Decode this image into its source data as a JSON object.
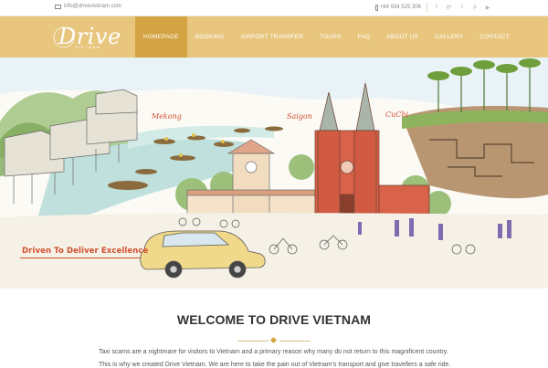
{
  "topbar": {
    "email": "info@drivevietnam.com",
    "phone": "+84 934 525 306",
    "social": [
      {
        "icon": "facebook-icon",
        "glyph": "f"
      },
      {
        "icon": "google-plus-icon",
        "glyph": "g+"
      },
      {
        "icon": "twitter-icon",
        "glyph": "t"
      },
      {
        "icon": "pinterest-icon",
        "glyph": "p"
      },
      {
        "icon": "youtube-icon",
        "glyph": "▶"
      }
    ]
  },
  "logo": {
    "word": "Drive",
    "sub": "VIETNAM"
  },
  "nav": {
    "items": [
      "HOMEPAGE",
      "BOOKING",
      "AIRPORT TRANSFER",
      "TOURS",
      "FAQ",
      "ABOUT US",
      "GALLERY",
      "CONTACT"
    ],
    "active_index": 0
  },
  "hero": {
    "places": [
      "Mekong",
      "Saigon",
      "CuChi"
    ],
    "tagline": "Driven To Deliver Excellence"
  },
  "intro": {
    "title": "WELCOME TO DRIVE VIETNAM",
    "line1": "Taxi scams are a nightmare for visitors to Vietnam and a primary reason why many do not return to this magnificent country.",
    "line2": "This is why we created Drive Vietnam. We are here to take the pain out of Vietnam's transport and give travellers a safe ride."
  },
  "colors": {
    "header": "#e8c67e",
    "active": "#d4a444",
    "accent_red": "#d2502f"
  }
}
